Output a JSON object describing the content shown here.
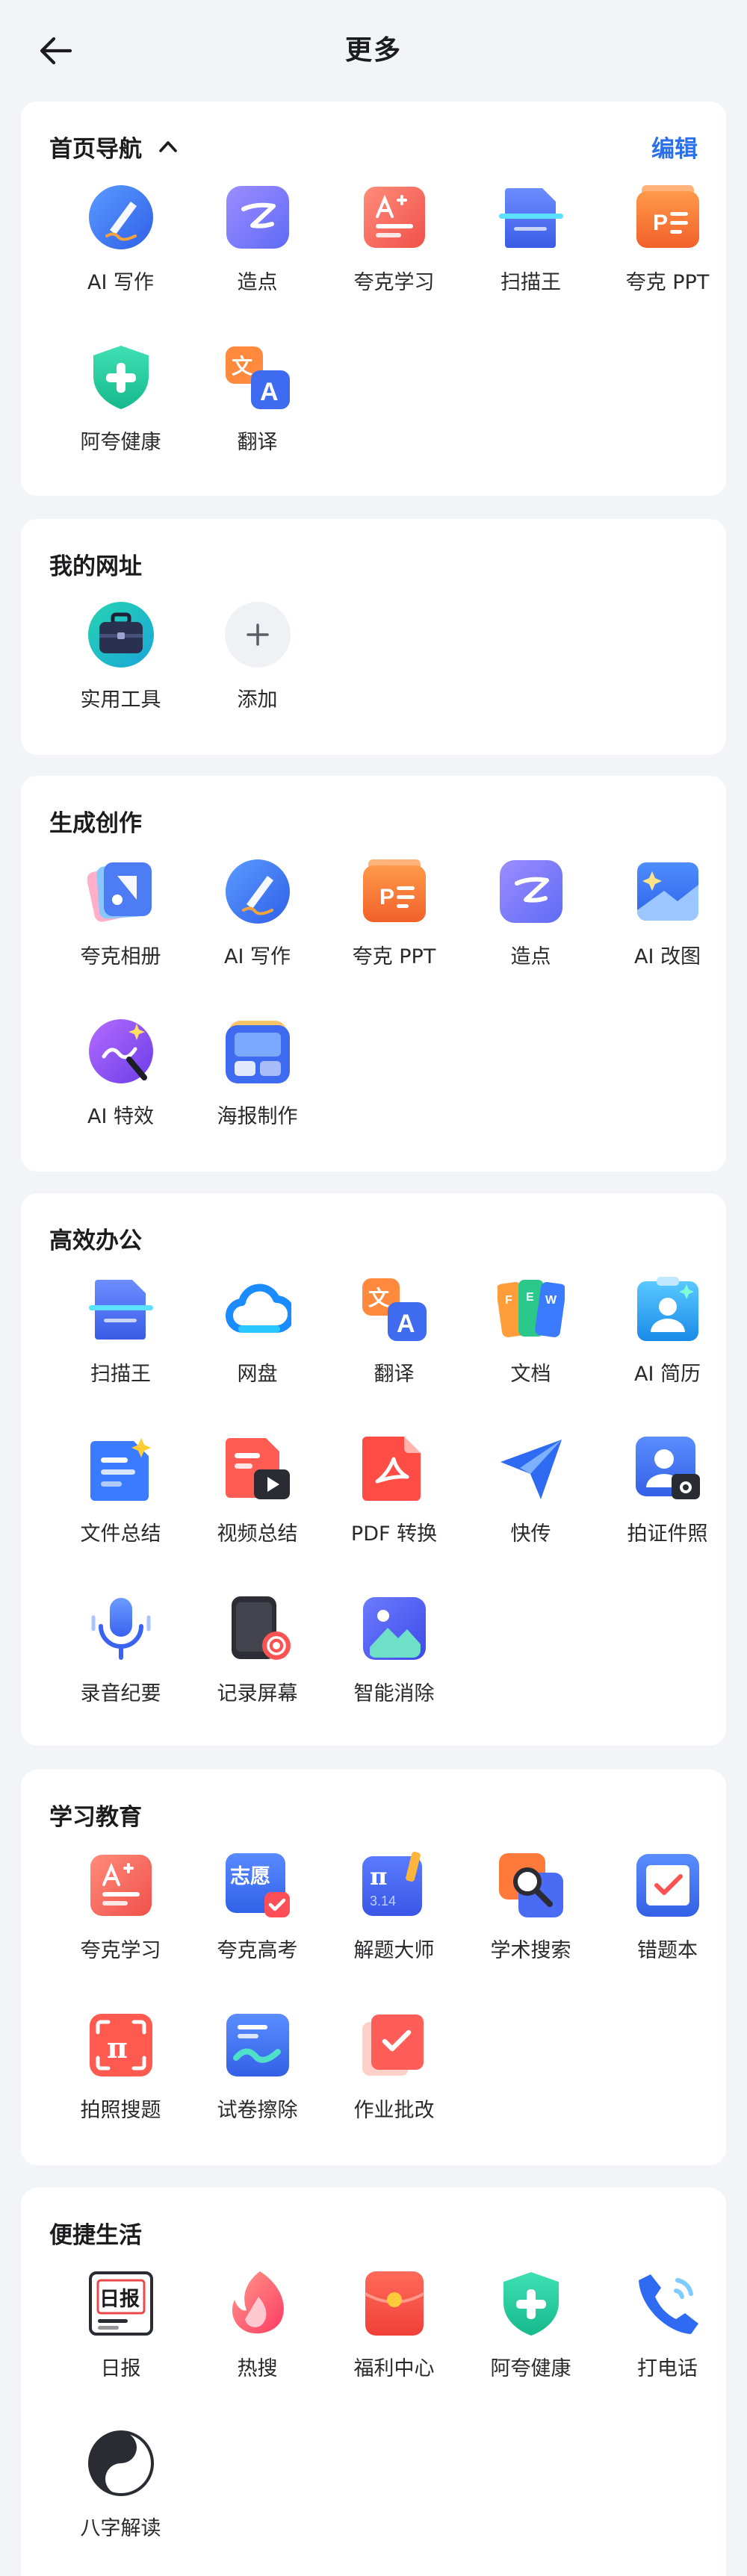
{
  "header": {
    "title": "更多",
    "back_icon": "arrow-left-icon"
  },
  "colors": {
    "accent": "#2b6fe9",
    "background": "#f3f4f7",
    "card": "#ffffff"
  },
  "sections": [
    {
      "title": "首页导航",
      "edit_label": "编辑",
      "items": [
        {
          "label": "AI 写作",
          "icon": "ai-write-icon"
        },
        {
          "label": "造点",
          "icon": "zaodian-icon"
        },
        {
          "label": "夸克学习",
          "icon": "quark-study-icon"
        },
        {
          "label": "扫描王",
          "icon": "scanner-icon"
        },
        {
          "label": "夸克 PPT",
          "icon": "ppt-icon"
        },
        {
          "label": "阿夸健康",
          "icon": "health-shield-icon"
        },
        {
          "label": "翻译",
          "icon": "translate-icon"
        }
      ]
    },
    {
      "title": "我的网址",
      "items": [
        {
          "label": "实用工具",
          "icon": "toolbox-icon"
        },
        {
          "label": "添加",
          "icon": "add-icon"
        }
      ]
    },
    {
      "title": "生成创作",
      "items": [
        {
          "label": "夸克相册",
          "icon": "album-icon"
        },
        {
          "label": "AI 写作",
          "icon": "ai-write-icon"
        },
        {
          "label": "夸克 PPT",
          "icon": "ppt-icon"
        },
        {
          "label": "造点",
          "icon": "zaodian-icon"
        },
        {
          "label": "AI 改图",
          "icon": "ai-image-edit-icon"
        },
        {
          "label": "AI 特效",
          "icon": "ai-effects-icon"
        },
        {
          "label": "海报制作",
          "icon": "poster-icon"
        }
      ]
    },
    {
      "title": "高效办公",
      "items": [
        {
          "label": "扫描王",
          "icon": "scanner-icon"
        },
        {
          "label": "网盘",
          "icon": "cloud-drive-icon"
        },
        {
          "label": "翻译",
          "icon": "translate-icon"
        },
        {
          "label": "文档",
          "icon": "documents-icon"
        },
        {
          "label": "AI 简历",
          "icon": "resume-icon"
        },
        {
          "label": "文件总结",
          "icon": "file-summary-icon"
        },
        {
          "label": "视频总结",
          "icon": "video-summary-icon"
        },
        {
          "label": "PDF 转换",
          "icon": "pdf-convert-icon"
        },
        {
          "label": "快传",
          "icon": "paper-plane-icon"
        },
        {
          "label": "拍证件照",
          "icon": "id-photo-icon"
        },
        {
          "label": "录音纪要",
          "icon": "microphone-icon"
        },
        {
          "label": "记录屏幕",
          "icon": "screen-record-icon"
        },
        {
          "label": "智能消除",
          "icon": "smart-erase-icon"
        }
      ]
    },
    {
      "title": "学习教育",
      "items": [
        {
          "label": "夸克学习",
          "icon": "quark-study-icon"
        },
        {
          "label": "夸克高考",
          "icon": "gaokao-icon"
        },
        {
          "label": "解题大师",
          "icon": "math-solver-icon"
        },
        {
          "label": "学术搜索",
          "icon": "academic-search-icon"
        },
        {
          "label": "错题本",
          "icon": "mistake-book-icon"
        },
        {
          "label": "拍照搜题",
          "icon": "photo-search-icon"
        },
        {
          "label": "试卷擦除",
          "icon": "paper-erase-icon"
        },
        {
          "label": "作业批改",
          "icon": "homework-check-icon"
        }
      ]
    },
    {
      "title": "便捷生活",
      "items": [
        {
          "label": "日报",
          "icon": "daily-news-icon",
          "glyph": "日报"
        },
        {
          "label": "热搜",
          "icon": "hot-search-icon"
        },
        {
          "label": "福利中心",
          "icon": "red-envelope-icon"
        },
        {
          "label": "阿夸健康",
          "icon": "health-shield-icon"
        },
        {
          "label": "打电话",
          "icon": "phone-icon"
        },
        {
          "label": "八字解读",
          "icon": "yin-yang-icon"
        }
      ]
    }
  ],
  "icon_glyphs": {
    "translate_a": "A",
    "translate_zh": "文",
    "volunteer": "志愿",
    "pi": "π",
    "pi_digits": "3.14",
    "ppt_p": "P",
    "doc_letters": [
      "F",
      "E",
      "W"
    ]
  }
}
